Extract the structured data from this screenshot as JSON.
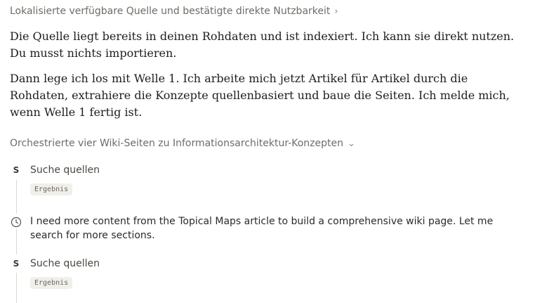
{
  "header_step": {
    "label": "Lokalisierte verfügbare Quelle und bestätigte direkte Nutzbarkeit",
    "chevron": "›"
  },
  "paragraphs": [
    "Die Quelle liegt bereits in deinen Rohdaten und ist indexiert. Ich kann sie direkt nutzen. Du musst nichts importieren.",
    "Dann lege ich los mit Welle 1. Ich arbeite mich jetzt Artikel für Artikel durch die Rohdaten, extrahiere die Konzepte quellenbasiert und baue die Seiten. Ich melde mich, wenn Welle 1 fertig ist."
  ],
  "orchestration": {
    "label": "Orchestrierte vier Wiki-Seiten zu Informationsarchitektur-Konzepten",
    "chevron": "⌄"
  },
  "steps": [
    {
      "icon_text": "S",
      "icon": "search-source-icon",
      "label": "Suche quellen",
      "badge": "Ergebnis"
    },
    {
      "icon": "clock-icon",
      "thought": "I need more content from the Topical Maps article to build a comprehensive wiki page. Let me search for more sections."
    },
    {
      "icon_text": "S",
      "icon": "search-source-icon",
      "label": "Suche quellen",
      "badge": "Ergebnis"
    }
  ]
}
